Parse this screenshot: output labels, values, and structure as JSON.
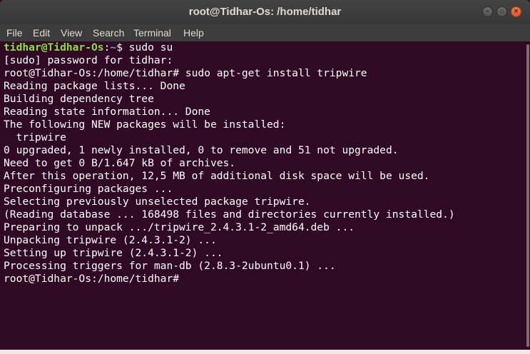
{
  "window": {
    "title": "root@Tidhar-Os: /home/tidhar"
  },
  "menubar": {
    "items": [
      "File",
      "Edit",
      "View",
      "Search",
      "Terminal",
      "Help"
    ]
  },
  "terminal": {
    "first_prompt": {
      "user_host": "tidhar@Tidhar-Os",
      "sep": ":",
      "path": "~",
      "symbol": "$",
      "command": " sudo su"
    },
    "lines": [
      "[sudo] password for tidhar:",
      "root@Tidhar-Os:/home/tidhar# sudo apt-get install tripwire",
      "Reading package lists... Done",
      "Building dependency tree",
      "Reading state information... Done",
      "The following NEW packages will be installed:",
      "  tripwire",
      "0 upgraded, 1 newly installed, 0 to remove and 51 not upgraded.",
      "Need to get 0 B/1.647 kB of archives.",
      "After this operation, 12,5 MB of additional disk space will be used.",
      "Preconfiguring packages ...",
      "Selecting previously unselected package tripwire.",
      "(Reading database ... 168498 files and directories currently installed.)",
      "Preparing to unpack .../tripwire_2.4.3.1-2_amd64.deb ...",
      "Unpacking tripwire (2.4.3.1-2) ...",
      "Setting up tripwire (2.4.3.1-2) ...",
      "Processing triggers for man-db (2.8.3-2ubuntu0.1) ...",
      "root@Tidhar-Os:/home/tidhar#"
    ]
  },
  "colors": {
    "background": "#300a24",
    "prompt_user": "#8ae234",
    "prompt_path": "#729fcf",
    "text": "#ffffff"
  },
  "icons": {
    "minimize": "minimize-icon",
    "maximize": "maximize-icon",
    "close": "close-icon"
  }
}
